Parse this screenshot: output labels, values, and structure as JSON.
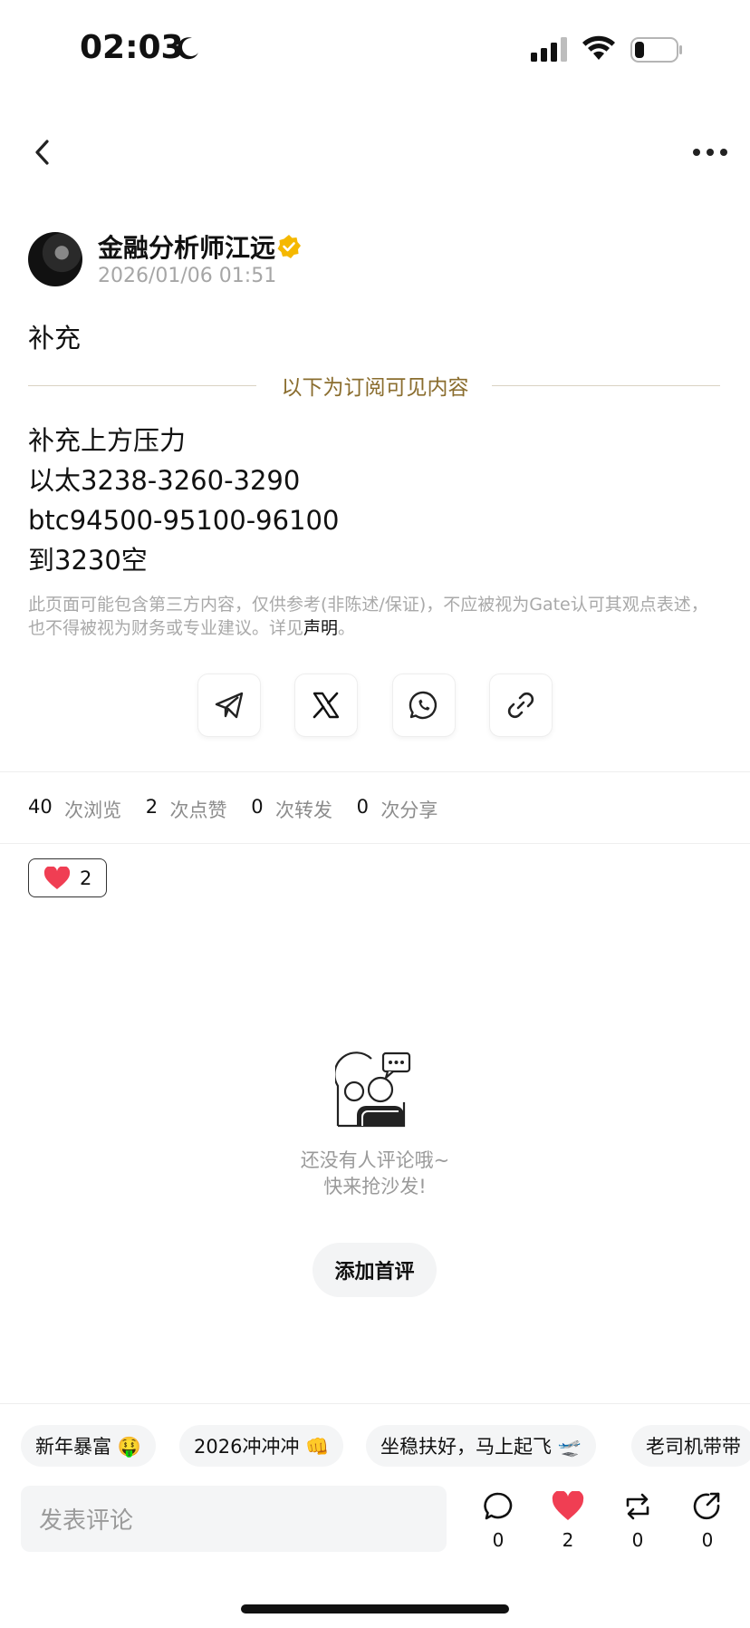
{
  "status_bar": {
    "time": "02:03",
    "icons": [
      "moon-icon",
      "signal-icon",
      "wifi-icon",
      "battery-icon"
    ]
  },
  "nav": {
    "back_icon": "chevron-left-icon",
    "more_icon": "more-horizontal-icon"
  },
  "post": {
    "author": "金融分析师江远",
    "verified_icon": "verified-badge-icon",
    "timestamp": "2026/01/06 01:51",
    "intro": "补充",
    "subscriber_divider": "以下为订阅可见内容",
    "lines": [
      "补充上方压力",
      "以太3238-3260-3290",
      "btc94500-95100-96100",
      "到3230空"
    ],
    "disclaimer": "此页面可能包含第三方内容，仅供参考(非陈述/保证)，不应被视为Gate认可其观点表述，也不得被视为财务或专业建议。详见",
    "disclaimer_link": "声明",
    "disclaimer_end": "。"
  },
  "share": [
    "telegram-icon",
    "x-icon",
    "whatsapp-icon",
    "link-icon"
  ],
  "stats": {
    "views_num": "40",
    "views_label": "次浏览",
    "likes_num": "2",
    "likes_label": "次点赞",
    "reposts_num": "0",
    "reposts_label": "次转发",
    "shares_num": "0",
    "shares_label": "次分享"
  },
  "reaction": {
    "icon": "heart-icon",
    "count": "2"
  },
  "comments_empty": {
    "line1": "还没有人评论哦~",
    "line2": "快来抢沙发!",
    "button": "添加首评"
  },
  "quick_replies": [
    "新年暴富 🤑",
    "2026冲冲冲 👊",
    "坐稳扶好，马上起飞 🛫",
    "老司机带带"
  ],
  "comment_input": {
    "placeholder": "发表评论"
  },
  "actions": [
    {
      "icon": "comment-icon",
      "count": "0"
    },
    {
      "icon": "heart-icon",
      "count": "2"
    },
    {
      "icon": "repost-icon",
      "count": "0"
    },
    {
      "icon": "share-icon",
      "count": "0"
    }
  ],
  "colors": {
    "accent_gold": "#8a6d2e",
    "like_red": "#f03e53",
    "verified_gold": "#f5b800"
  }
}
